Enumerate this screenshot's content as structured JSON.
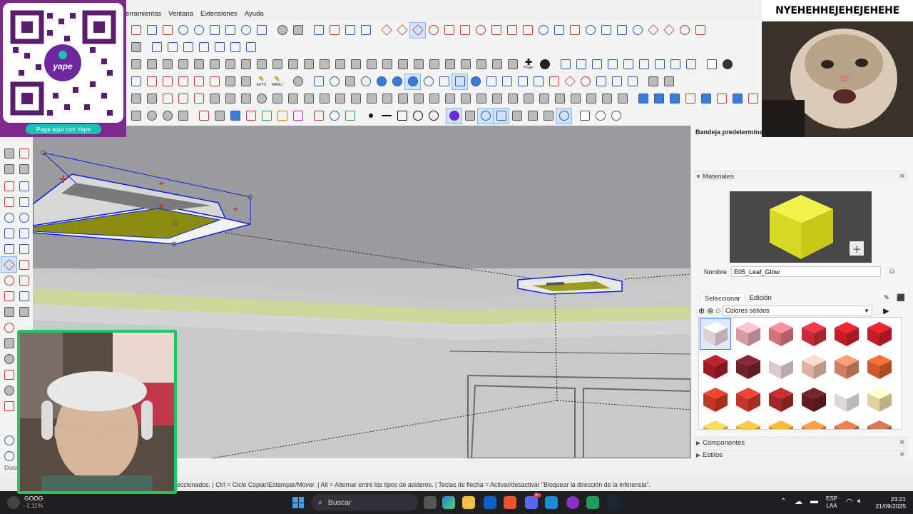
{
  "menu": {
    "items": [
      "erramientas",
      "Ventana",
      "Extensiones",
      "Ayuda"
    ]
  },
  "overlays": {
    "qr_caption": "Paga aquí con Yape",
    "qr_brand": "yape",
    "cat_caption": "NYEHEHHEJEHEJEHEHE"
  },
  "tray": {
    "title": "Bandeja predeterminad",
    "materials_panel": "Materiales",
    "name_label": "Nombre",
    "material_name": "E05_Leaf_Glow",
    "tab_select": "Seleccionar",
    "tab_edit": "Edición",
    "library": "Colores sólidos",
    "components_panel": "Componentes",
    "styles_panel": "Estilos",
    "preview_color": "#e6e62e",
    "swatches": [
      "#f2e2e6",
      "#e8aab6",
      "#e07c86",
      "#d6303c",
      "#d4202c",
      "#d41e2a",
      "#a81e2a",
      "#7a2430",
      "#f0dada",
      "#f0c0b0",
      "#e08a6a",
      "#e06030",
      "#d63a26",
      "#d43a30",
      "#b02a2a",
      "#6a1e24",
      "#f4eaea",
      "#f4e2b0",
      "#f2c050",
      "#f0b040",
      "#f0a030",
      "#e88a40",
      "#d07040",
      "#c06848"
    ]
  },
  "toolbar": {
    "plugin_label": "Plugin",
    "auto_label": "AUTO",
    "manu_label": "MANU"
  },
  "status": {
    "message": "eccionados. | Ctrl = Ciclo Copiar/Estampar/Mover. | Alt = Alternar entre los tipos de asideros. | Teclas de flecha = Activar/desactivar \"Bloquear la dirección de la inferencia\".",
    "side_label": "Dista"
  },
  "taskbar": {
    "ticker": "GOOG",
    "change": "-1.11%",
    "search_placeholder": "Buscar",
    "lang_top": "ESP",
    "lang_bottom": "LAA",
    "time": "23:21",
    "date": "21/09/2025",
    "badge_count": "9+"
  },
  "viewport": {
    "ceiling_color": "#9a9b9e",
    "fixture_color": "#8a8c10",
    "trim_color": "#cfd69a",
    "selection_color": "#1020e0"
  }
}
